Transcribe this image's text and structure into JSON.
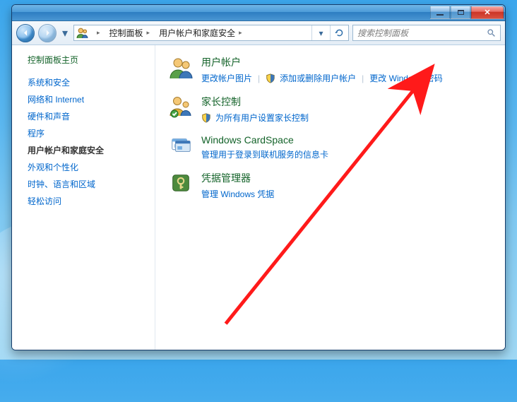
{
  "breadcrumb": {
    "root": "控制面板",
    "current": "用户帐户和家庭安全"
  },
  "search": {
    "placeholder": "搜索控制面板"
  },
  "sidebar": {
    "home": "控制面板主页",
    "links": [
      "系统和安全",
      "网络和 Internet",
      "硬件和声音",
      "程序",
      "用户帐户和家庭安全",
      "外观和个性化",
      "时钟、语言和区域",
      "轻松访问"
    ],
    "currentIndex": 4
  },
  "sections": [
    {
      "title": "用户帐户",
      "links": [
        {
          "label": "更改帐户图片",
          "shield": false
        },
        {
          "label": "添加或删除用户帐户",
          "shield": true
        },
        {
          "label": "更改 Windows 密码",
          "shield": false
        }
      ]
    },
    {
      "title": "家长控制",
      "links": [
        {
          "label": "为所有用户设置家长控制",
          "shield": true
        }
      ]
    },
    {
      "title": "Windows CardSpace",
      "links": [
        {
          "label": "管理用于登录到联机服务的信息卡",
          "shield": false
        }
      ]
    },
    {
      "title": "凭据管理器",
      "links": [
        {
          "label": "管理 Windows 凭据",
          "shield": false
        }
      ]
    }
  ]
}
